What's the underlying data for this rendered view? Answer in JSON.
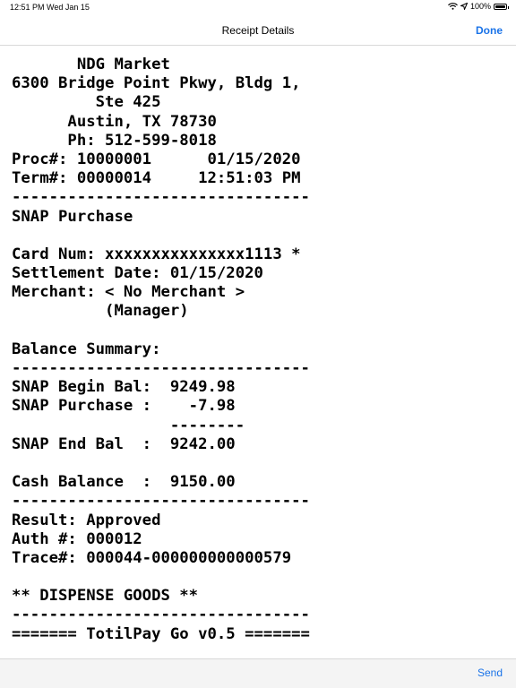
{
  "status_bar": {
    "time": "12:51 PM",
    "date": "Wed Jan 15",
    "battery": "100%",
    "battery_level": 1.0,
    "icons": [
      "wifi-icon",
      "location-icon",
      "battery-icon"
    ]
  },
  "nav": {
    "title": "Receipt Details",
    "done_label": "Done"
  },
  "receipt": {
    "lines": [
      "       NDG Market",
      "6300 Bridge Point Pkwy, Bldg 1,",
      "         Ste 425",
      "      Austin, TX 78730",
      "      Ph: 512-599-8018",
      "Proc#: 10000001      01/15/2020",
      "Term#: 00000014     12:51:03 PM",
      "--------------------------------",
      "SNAP Purchase",
      "",
      "Card Num: xxxxxxxxxxxxxxx1113 *",
      "Settlement Date: 01/15/2020",
      "Merchant: < No Merchant >",
      "          (Manager)",
      "",
      "Balance Summary:",
      "--------------------------------",
      "SNAP Begin Bal:  9249.98",
      "SNAP Purchase :    -7.98",
      "                 --------",
      "SNAP End Bal  :  9242.00",
      "",
      "Cash Balance  :  9150.00",
      "--------------------------------",
      "Result: Approved",
      "Auth #: 000012",
      "Trace#: 000044-000000000000579",
      "",
      "** DISPENSE GOODS **",
      "--------------------------------",
      "======= TotilPay Go v0.5 ======="
    ]
  },
  "bottom_bar": {
    "send_label": "Send"
  },
  "colors": {
    "accent": "#1a73e8",
    "text": "#000000",
    "divider": "#d8d8d8",
    "toolbar_bg": "#f4f4f4"
  }
}
